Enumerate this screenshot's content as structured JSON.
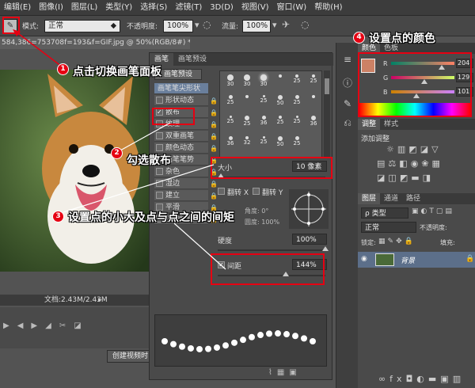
{
  "menubar": {
    "items": [
      "编辑(E)",
      "图像(I)",
      "图层(L)",
      "类型(Y)",
      "选择(S)",
      "滤镜(T)",
      "3D(D)",
      "视图(V)",
      "窗口(W)",
      "帮助(H)"
    ]
  },
  "options": {
    "mode_label": "模式:",
    "mode_value": "正常",
    "opacity_label": "不透明度:",
    "opacity_value": "100%",
    "flow_label": "流量:",
    "flow_value": "100%"
  },
  "document": {
    "tab_title": "584,386=753708f=193&f=GIF.jpg @ 50%(RGB/8#) *",
    "tab_close": "×",
    "status_text": "文档:2.43M/2.43M",
    "create_video_button": "创建视频时"
  },
  "brush_panel": {
    "tabs": [
      "画笔",
      "画笔预设"
    ],
    "preset_button": "画笔预设",
    "list": [
      {
        "label": "画笔笔尖形状",
        "checked": null
      },
      {
        "label": "形状动态",
        "checked": false
      },
      {
        "label": "散布",
        "checked": true
      },
      {
        "label": "纹理",
        "checked": false
      },
      {
        "label": "双重画笔",
        "checked": false
      },
      {
        "label": "颜色动态",
        "checked": false
      },
      {
        "label": "画笔笔势",
        "checked": false
      },
      {
        "label": "杂色",
        "checked": false
      },
      {
        "label": "湿边",
        "checked": false
      },
      {
        "label": "建立",
        "checked": false
      },
      {
        "label": "平滑",
        "checked": false
      },
      {
        "label": "保护纹理",
        "checked": false
      }
    ],
    "tip_sizes": [
      "30",
      "30",
      "30",
      "",
      "25",
      "25",
      "25",
      "",
      "25",
      "50",
      "25",
      "",
      "25",
      "25",
      "36",
      "25",
      "25",
      "36",
      "36",
      "32",
      "25",
      "50",
      "25"
    ],
    "size_label": "大小",
    "size_value": "10 像素",
    "flip_x": "翻转 X",
    "flip_y": "翻转 Y",
    "angle_label": "角度: 0°",
    "roundness_label": "圆度: 100%",
    "hardness_label": "硬度",
    "hardness_value": "100%",
    "spacing_label": "间距",
    "spacing_value": "144%",
    "spacing_checked": true
  },
  "color_panel": {
    "tabs": [
      "颜色",
      "色板"
    ],
    "r_label": "R",
    "g_label": "G",
    "b_label": "B",
    "r_value": "204",
    "g_value": "129",
    "b_value": "101",
    "fg_color": "#cc8165"
  },
  "adjust_panel": {
    "tabs": [
      "调整",
      "样式"
    ],
    "title": "添加调整"
  },
  "layers_panel": {
    "tabs": [
      "图层",
      "通道",
      "路径"
    ],
    "filter_label": "ρ 类型",
    "blend_value": "正常",
    "opacity_label": "不透明度:",
    "lock_label": "锁定:",
    "fill_label": "填充:",
    "layer_name": "背景"
  },
  "annotations": {
    "a1": {
      "num": "1",
      "text": "点击切换画笔面板"
    },
    "a2": {
      "num": "2",
      "text": "勾选散布"
    },
    "a3": {
      "num": "3",
      "text": "设置点的小大及点与点之间的间矩"
    },
    "a4": {
      "num": "4",
      "text": "设置点的颜色"
    }
  }
}
